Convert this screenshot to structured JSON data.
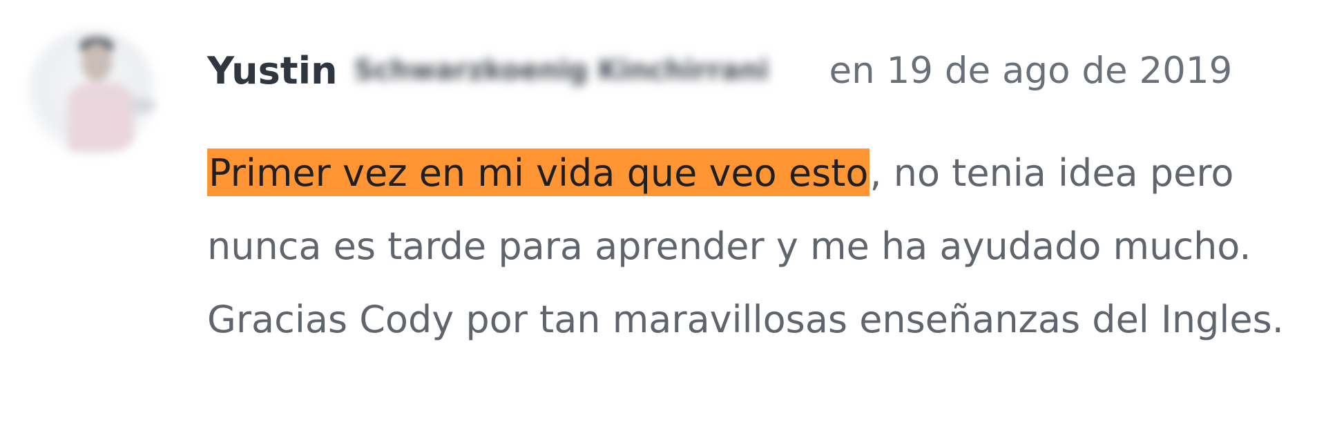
{
  "comment": {
    "author_first_name": "Yustin",
    "author_last_name_obscured": "Schwarzkoenig Kinchirrani",
    "date": "en 19 de ago de 2019",
    "highlighted_text": "Primer vez en mi vida que veo esto",
    "body_rest": ", no tenia idea pero nunca es tarde para aprender y me ha ayudado mucho. Gracias Cody por tan maravillosas enseñanzas del Ingles.",
    "highlight_color": "#ff9533"
  },
  "avatar": {
    "icon": "user-avatar-photo"
  }
}
